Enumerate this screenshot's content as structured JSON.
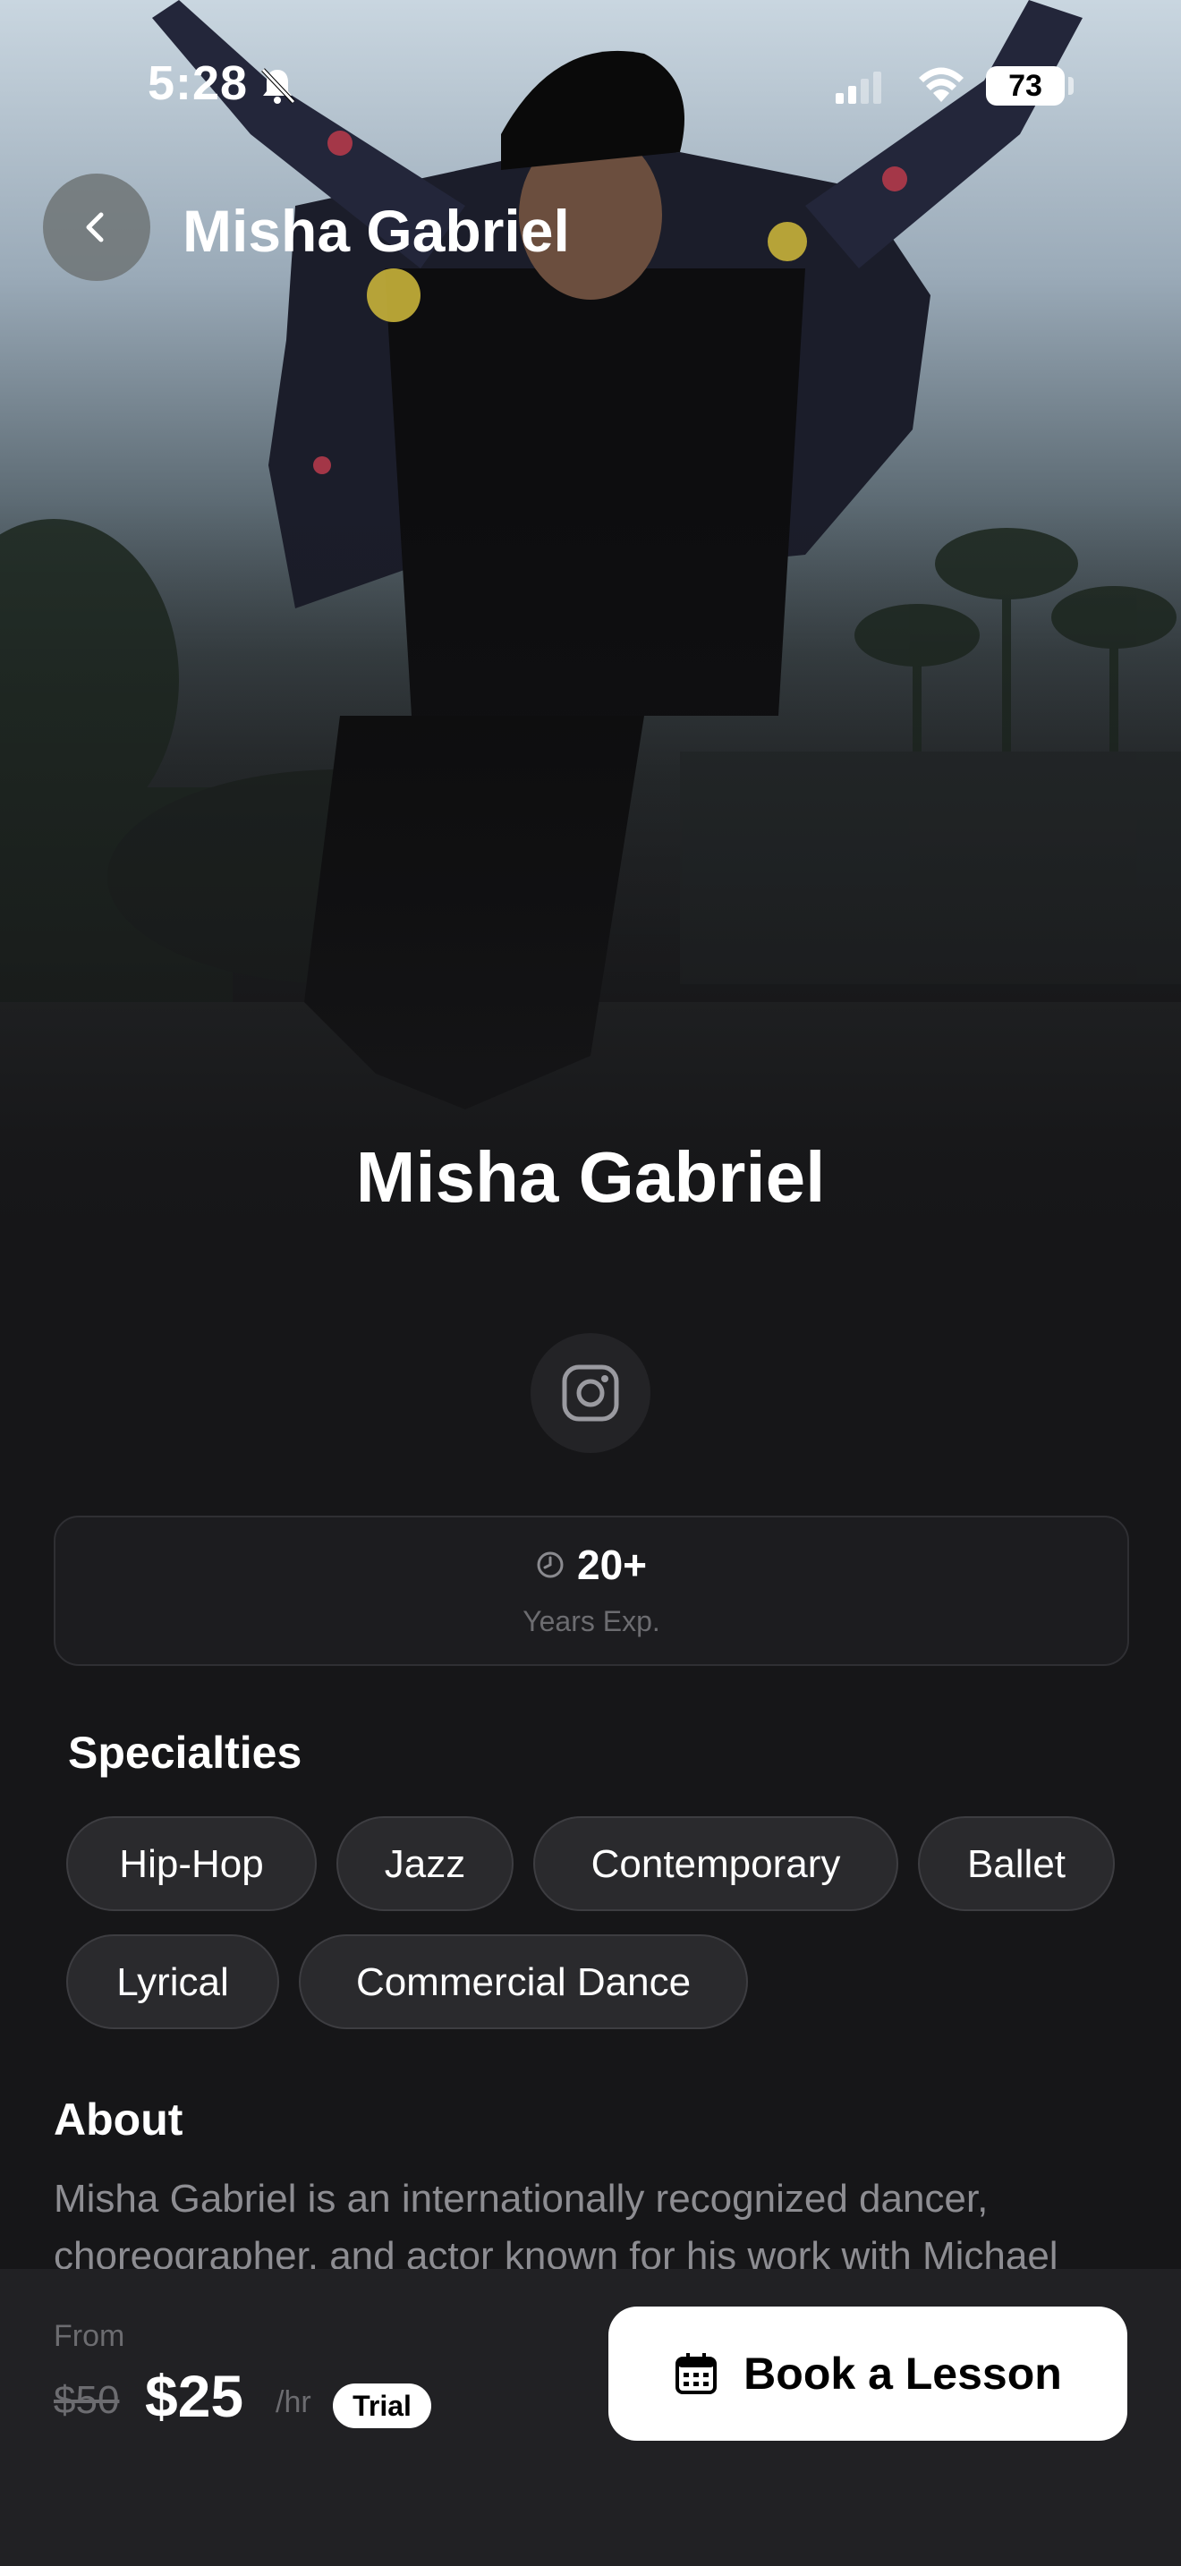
{
  "status_bar": {
    "time": "5:28",
    "battery": "73"
  },
  "header": {
    "title": "Misha Gabriel"
  },
  "profile": {
    "name": "Misha Gabriel"
  },
  "stats": {
    "value": "20+",
    "label": "Years Exp."
  },
  "specialties": {
    "title": "Specialties",
    "items": [
      "Hip-Hop",
      "Jazz",
      "Contemporary",
      "Ballet",
      "Lyrical",
      "Commercial Dance"
    ]
  },
  "about": {
    "title": "About",
    "text": "Misha Gabriel is an internationally recognized dancer, choreographer, and actor known for his work with Michael"
  },
  "pricing": {
    "from_label": "From",
    "old_price": "$50",
    "price": "$25",
    "unit": "/hr",
    "badge": "Trial"
  },
  "cta": {
    "label": "Book a Lesson"
  },
  "icons": [
    "bell-slash-icon",
    "signal-icon",
    "wifi-icon",
    "chevron-left-icon",
    "instagram-icon",
    "clock-icon",
    "calendar-icon"
  ]
}
